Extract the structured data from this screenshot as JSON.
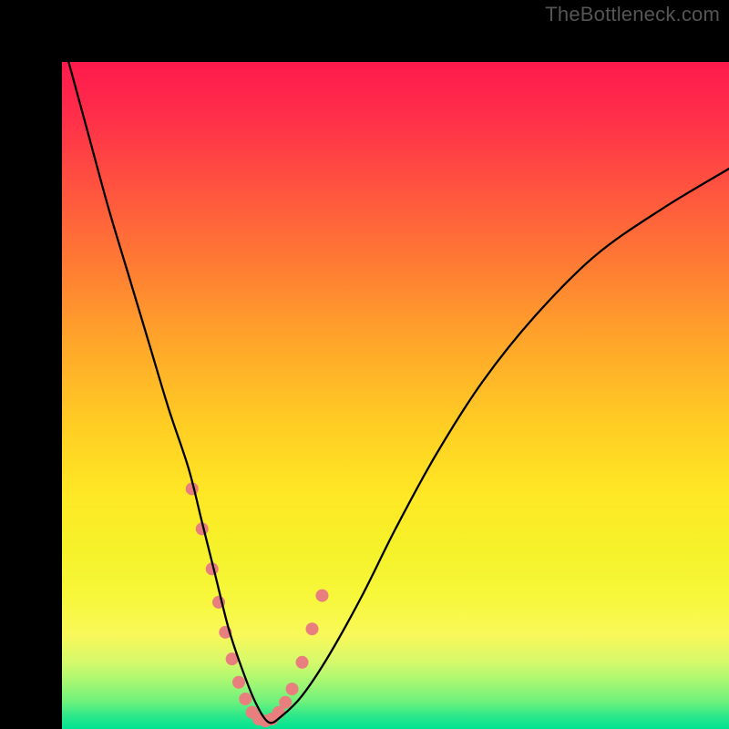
{
  "watermark": "TheBottleneck.com",
  "chart_data": {
    "type": "line",
    "title": "",
    "xlabel": "",
    "ylabel": "",
    "xlim": [
      0,
      100
    ],
    "ylim": [
      0,
      100
    ],
    "curve": {
      "name": "bottleneck-curve",
      "x": [
        1,
        4,
        7,
        10,
        13,
        16,
        19,
        21,
        23,
        25,
        27,
        29,
        31,
        33,
        36,
        40,
        45,
        50,
        56,
        63,
        71,
        80,
        90,
        100
      ],
      "y": [
        100,
        89,
        78,
        68,
        58,
        48,
        39,
        31,
        23,
        15,
        9,
        4,
        1,
        2,
        5,
        11,
        20,
        30,
        41,
        52,
        62,
        71,
        78,
        84
      ]
    },
    "markers": {
      "name": "highlighted-points",
      "x": [
        19.5,
        21.0,
        22.5,
        23.5,
        24.5,
        25.5,
        26.5,
        27.5,
        28.5,
        29.5,
        30.5,
        31.5,
        32.5,
        33.5,
        34.5,
        36.0,
        37.5,
        39.0
      ],
      "y": [
        36.0,
        30.0,
        24.0,
        19.0,
        14.5,
        10.5,
        7.0,
        4.5,
        2.5,
        1.5,
        1.2,
        1.5,
        2.5,
        4.0,
        6.0,
        10.0,
        15.0,
        20.0
      ],
      "color": "#e97e7e",
      "radius": 7
    },
    "background_gradient": {
      "top_color": "#ff1a4d",
      "bottom_color": "#00e392"
    }
  }
}
